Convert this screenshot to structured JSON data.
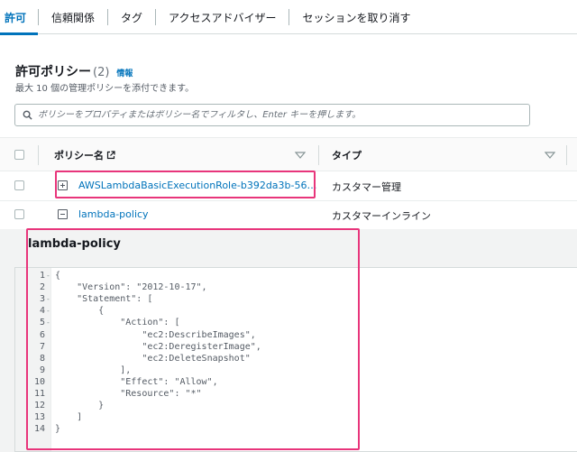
{
  "tabs": [
    {
      "label": "許可",
      "active": true
    },
    {
      "label": "信頼関係"
    },
    {
      "label": "タグ"
    },
    {
      "label": "アクセスアドバイザー"
    },
    {
      "label": "セッションを取り消す"
    }
  ],
  "section": {
    "title": "許可ポリシー",
    "count": "(2)",
    "info": "情報",
    "description": "最大 10 個の管理ポリシーを添付できます。"
  },
  "search": {
    "placeholder": "ポリシーをプロパティまたはポリシー名でフィルタし、Enter キーを押します。",
    "value": ""
  },
  "table": {
    "columns": [
      "ポリシー名",
      "タイプ"
    ],
    "rows": [
      {
        "name": "AWSLambdaBasicExecutionRole-b392da3b-56…",
        "type": "カスタマー管理",
        "expanded": false
      },
      {
        "name": "lambda-policy",
        "type": "カスタマーインライン",
        "expanded": true
      }
    ]
  },
  "policy": {
    "title": "lambda-policy",
    "lines": [
      {
        "n": "1",
        "fold": "-",
        "text": "{"
      },
      {
        "n": "2",
        "fold": "",
        "text": "    \"Version\": \"2012-10-17\","
      },
      {
        "n": "3",
        "fold": "-",
        "text": "    \"Statement\": ["
      },
      {
        "n": "4",
        "fold": "-",
        "text": "        {"
      },
      {
        "n": "5",
        "fold": "-",
        "text": "            \"Action\": ["
      },
      {
        "n": "6",
        "fold": "",
        "text": "                \"ec2:DescribeImages\","
      },
      {
        "n": "7",
        "fold": "",
        "text": "                \"ec2:DeregisterImage\","
      },
      {
        "n": "8",
        "fold": "",
        "text": "                \"ec2:DeleteSnapshot\""
      },
      {
        "n": "9",
        "fold": "",
        "text": "            ],"
      },
      {
        "n": "10",
        "fold": "",
        "text": "            \"Effect\": \"Allow\","
      },
      {
        "n": "11",
        "fold": "",
        "text": "            \"Resource\": \"*\""
      },
      {
        "n": "12",
        "fold": "",
        "text": "        }"
      },
      {
        "n": "13",
        "fold": "",
        "text": "    ]"
      },
      {
        "n": "14",
        "fold": "",
        "text": "}"
      }
    ]
  },
  "colors": {
    "accent": "#0073bb",
    "highlight": "#e8357b"
  },
  "icons": [
    "search-icon",
    "external-link-icon",
    "sort-down-icon",
    "expand-plus-icon",
    "collapse-minus-icon"
  ]
}
